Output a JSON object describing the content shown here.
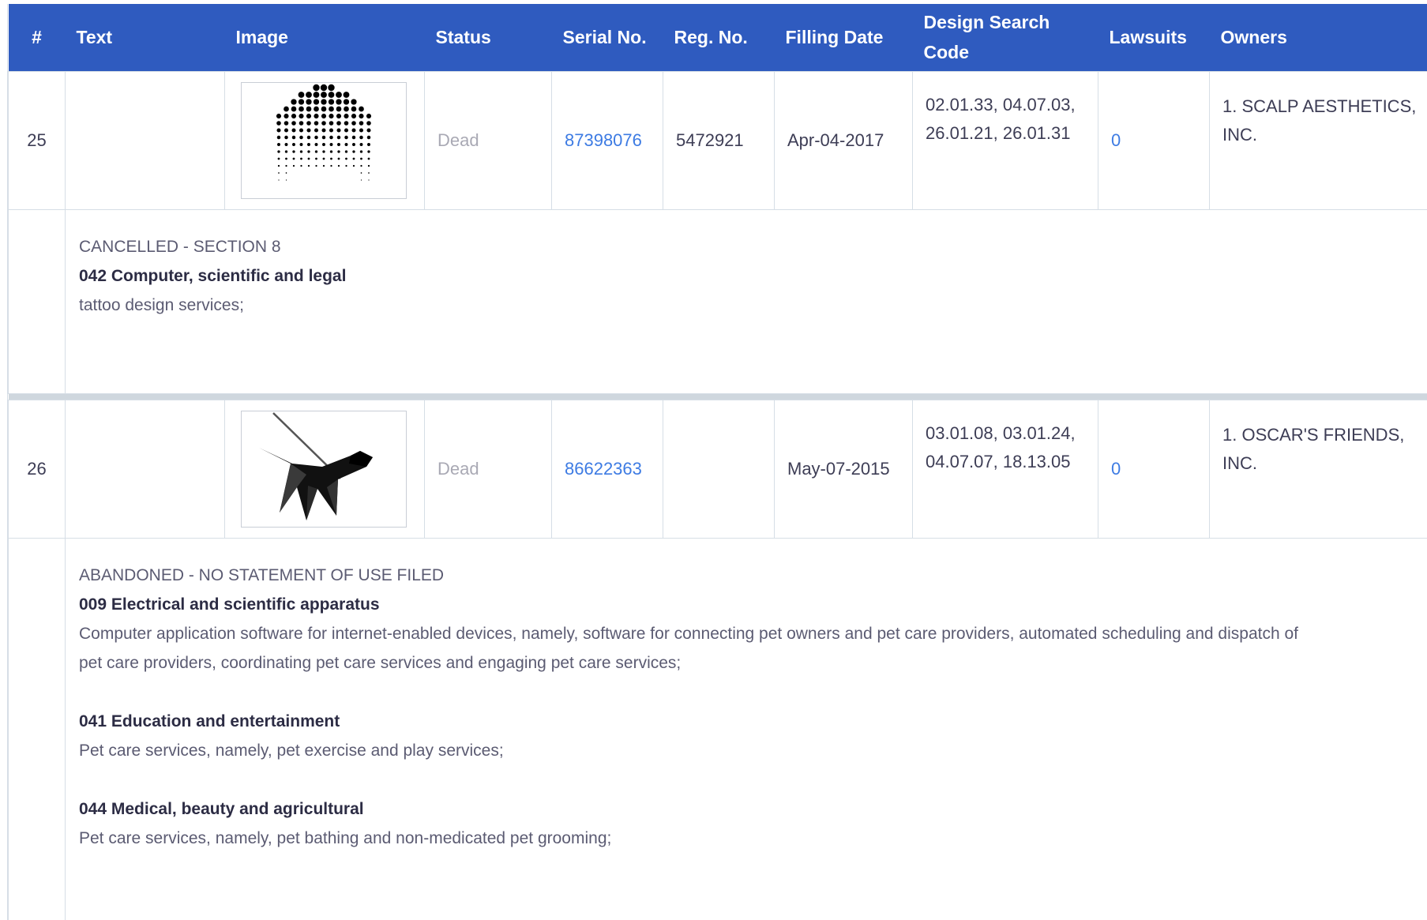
{
  "header": {
    "num": "#",
    "text": "Text",
    "image": "Image",
    "status": "Status",
    "serial": "Serial No.",
    "reg": "Reg. No.",
    "filling": "Filling Date",
    "design_line1": "Design Search",
    "design_line2": "Code",
    "lawsuits": "Lawsuits",
    "owners": "Owners"
  },
  "rows": [
    {
      "num": "25",
      "text": "",
      "image_icon": "dotted-dome-logo-icon",
      "status": "Dead",
      "serial": "87398076",
      "reg": "5472921",
      "filling": "Apr-04-2017",
      "design_line1": "02.01.33, 04.07.03,",
      "design_line2": "26.01.21, 26.01.31",
      "lawsuits": "0",
      "owners_line1": "1. SCALP AESTHETICS,",
      "owners_line2": "INC.",
      "detail": {
        "status_text": "CANCELLED - SECTION 8",
        "classes": [
          {
            "title": "042 Computer, scientific and legal",
            "desc": "tattoo design services;"
          }
        ]
      }
    },
    {
      "num": "26",
      "text": "",
      "image_icon": "dog-on-leash-logo-icon",
      "status": "Dead",
      "serial": "86622363",
      "reg": "",
      "filling": "May-07-2015",
      "design_line1": "03.01.08, 03.01.24,",
      "design_line2": "04.07.07, 18.13.05",
      "lawsuits": "0",
      "owners_line1": "1. OSCAR'S FRIENDS,",
      "owners_line2": "INC.",
      "detail": {
        "status_text": "ABANDONED - NO STATEMENT OF USE FILED",
        "classes": [
          {
            "title": "009 Electrical and scientific apparatus",
            "desc_line1": "Computer application software for internet-enabled devices, namely, software for connecting pet owners and pet care providers, automated scheduling and dispatch of",
            "desc_line2": "pet care providers, coordinating pet care services and engaging pet care services;"
          },
          {
            "title": "041 Education and entertainment",
            "desc": "Pet care services, namely, pet exercise and play services;"
          },
          {
            "title": "044 Medical, beauty and agricultural",
            "desc": "Pet care services, namely, pet bathing and non-medicated pet grooming;"
          }
        ]
      }
    }
  ]
}
